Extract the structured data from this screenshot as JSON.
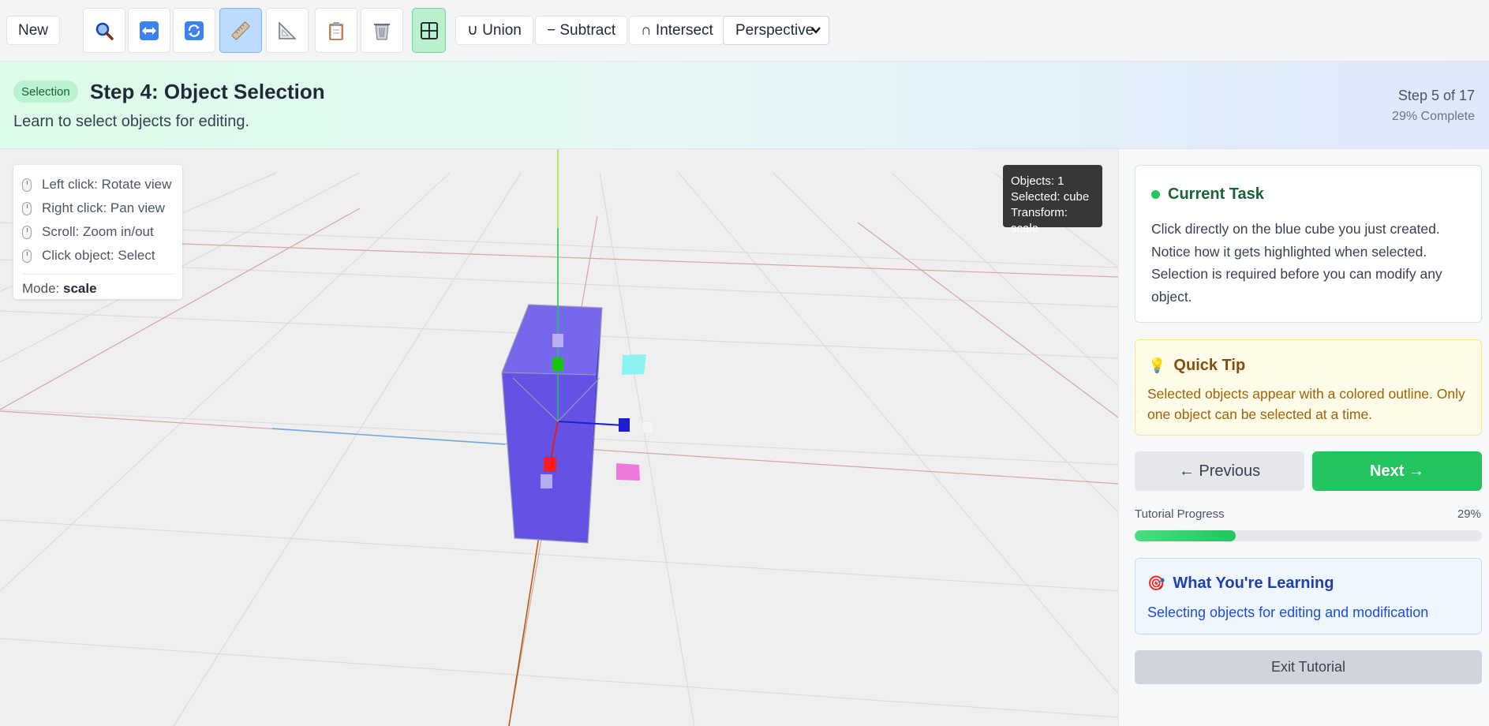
{
  "toolbar": {
    "new_label": "New",
    "tools": [
      {
        "name": "zoom-tool",
        "icon": "magnifier-icon"
      },
      {
        "name": "move-tool",
        "icon": "move-arrows-icon"
      },
      {
        "name": "rotate-tool",
        "icon": "rotate-icon"
      },
      {
        "name": "scale-tool",
        "icon": "ruler-icon",
        "active": true
      },
      {
        "name": "measure-tool",
        "icon": "set-square-icon"
      },
      {
        "name": "paste-tool",
        "icon": "clipboard-icon"
      },
      {
        "name": "delete-tool",
        "icon": "trash-icon"
      },
      {
        "name": "grid-toggle",
        "icon": "grid-icon",
        "active": true
      }
    ],
    "union_label": "∪ Union",
    "subtract_label": "− Subtract",
    "intersect_label": "∩ Intersect",
    "view_select": "Perspective"
  },
  "banner": {
    "badge": "Selection",
    "title": "Step 4: Object Selection",
    "description": "Learn to select objects for editing.",
    "step_count": "Step 5 of 17",
    "complete": "29% Complete"
  },
  "viewport": {
    "help": [
      "Left click: Rotate view",
      "Right click: Pan view",
      "Scroll: Zoom in/out",
      "Click object: Select"
    ],
    "mode_label": "Mode:",
    "mode_value": "scale",
    "stats": {
      "objects": "Objects: 1",
      "selected": "Selected: cube",
      "transform": "Transform: scale"
    },
    "colors": {
      "cube": "#6352e4",
      "axis_x": "#e11d1d",
      "axis_y": "#22c55e",
      "axis_z": "#1d1dd8"
    }
  },
  "sidebar": {
    "task": {
      "title": "Current Task",
      "body": "Click directly on the blue cube you just created. Notice how it gets highlighted when selected. Selection is required before you can modify any object."
    },
    "tip": {
      "icon": "💡",
      "title": "Quick Tip",
      "body": "Selected objects appear with a colored outline. Only one object can be selected at a time."
    },
    "prev_label": "← Previous",
    "next_label": "Next →",
    "progress_label": "Tutorial Progress",
    "progress_value": "29%",
    "progress_fraction": 0.29,
    "learning": {
      "icon": "🎯",
      "title": "What You're Learning",
      "body": "Selecting objects for editing and modification"
    },
    "exit_label": "Exit Tutorial"
  }
}
